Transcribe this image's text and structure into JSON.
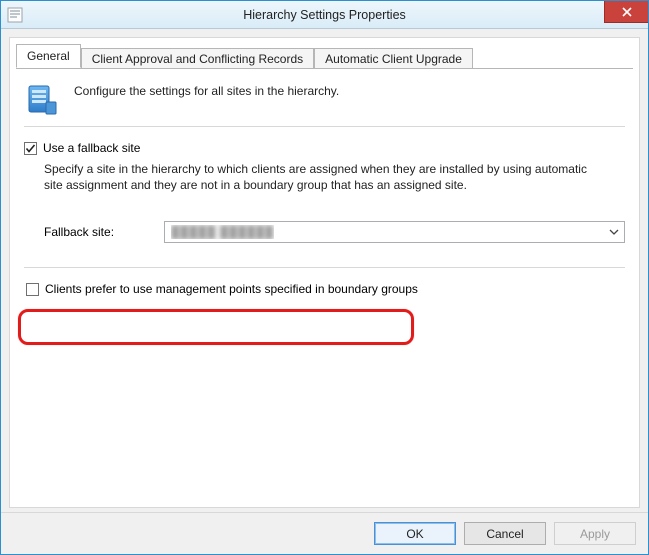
{
  "window": {
    "title": "Hierarchy Settings Properties"
  },
  "tabs": {
    "general": "General",
    "approval": "Client Approval and Conflicting Records",
    "upgrade": "Automatic Client Upgrade"
  },
  "intro": {
    "text": "Configure the settings for all sites in the hierarchy."
  },
  "fallback": {
    "checkbox_label": "Use a fallback site",
    "checked": true,
    "description": "Specify a site in the hierarchy to which clients are assigned when they are installed by using automatic site assignment and they are not in a boundary group that has an assigned site.",
    "label": "Fallback site:",
    "value": "█████ ██████"
  },
  "prefer_mp": {
    "checkbox_label": "Clients prefer to use management points specified in boundary groups",
    "checked": false
  },
  "buttons": {
    "ok": "OK",
    "cancel": "Cancel",
    "apply": "Apply"
  }
}
